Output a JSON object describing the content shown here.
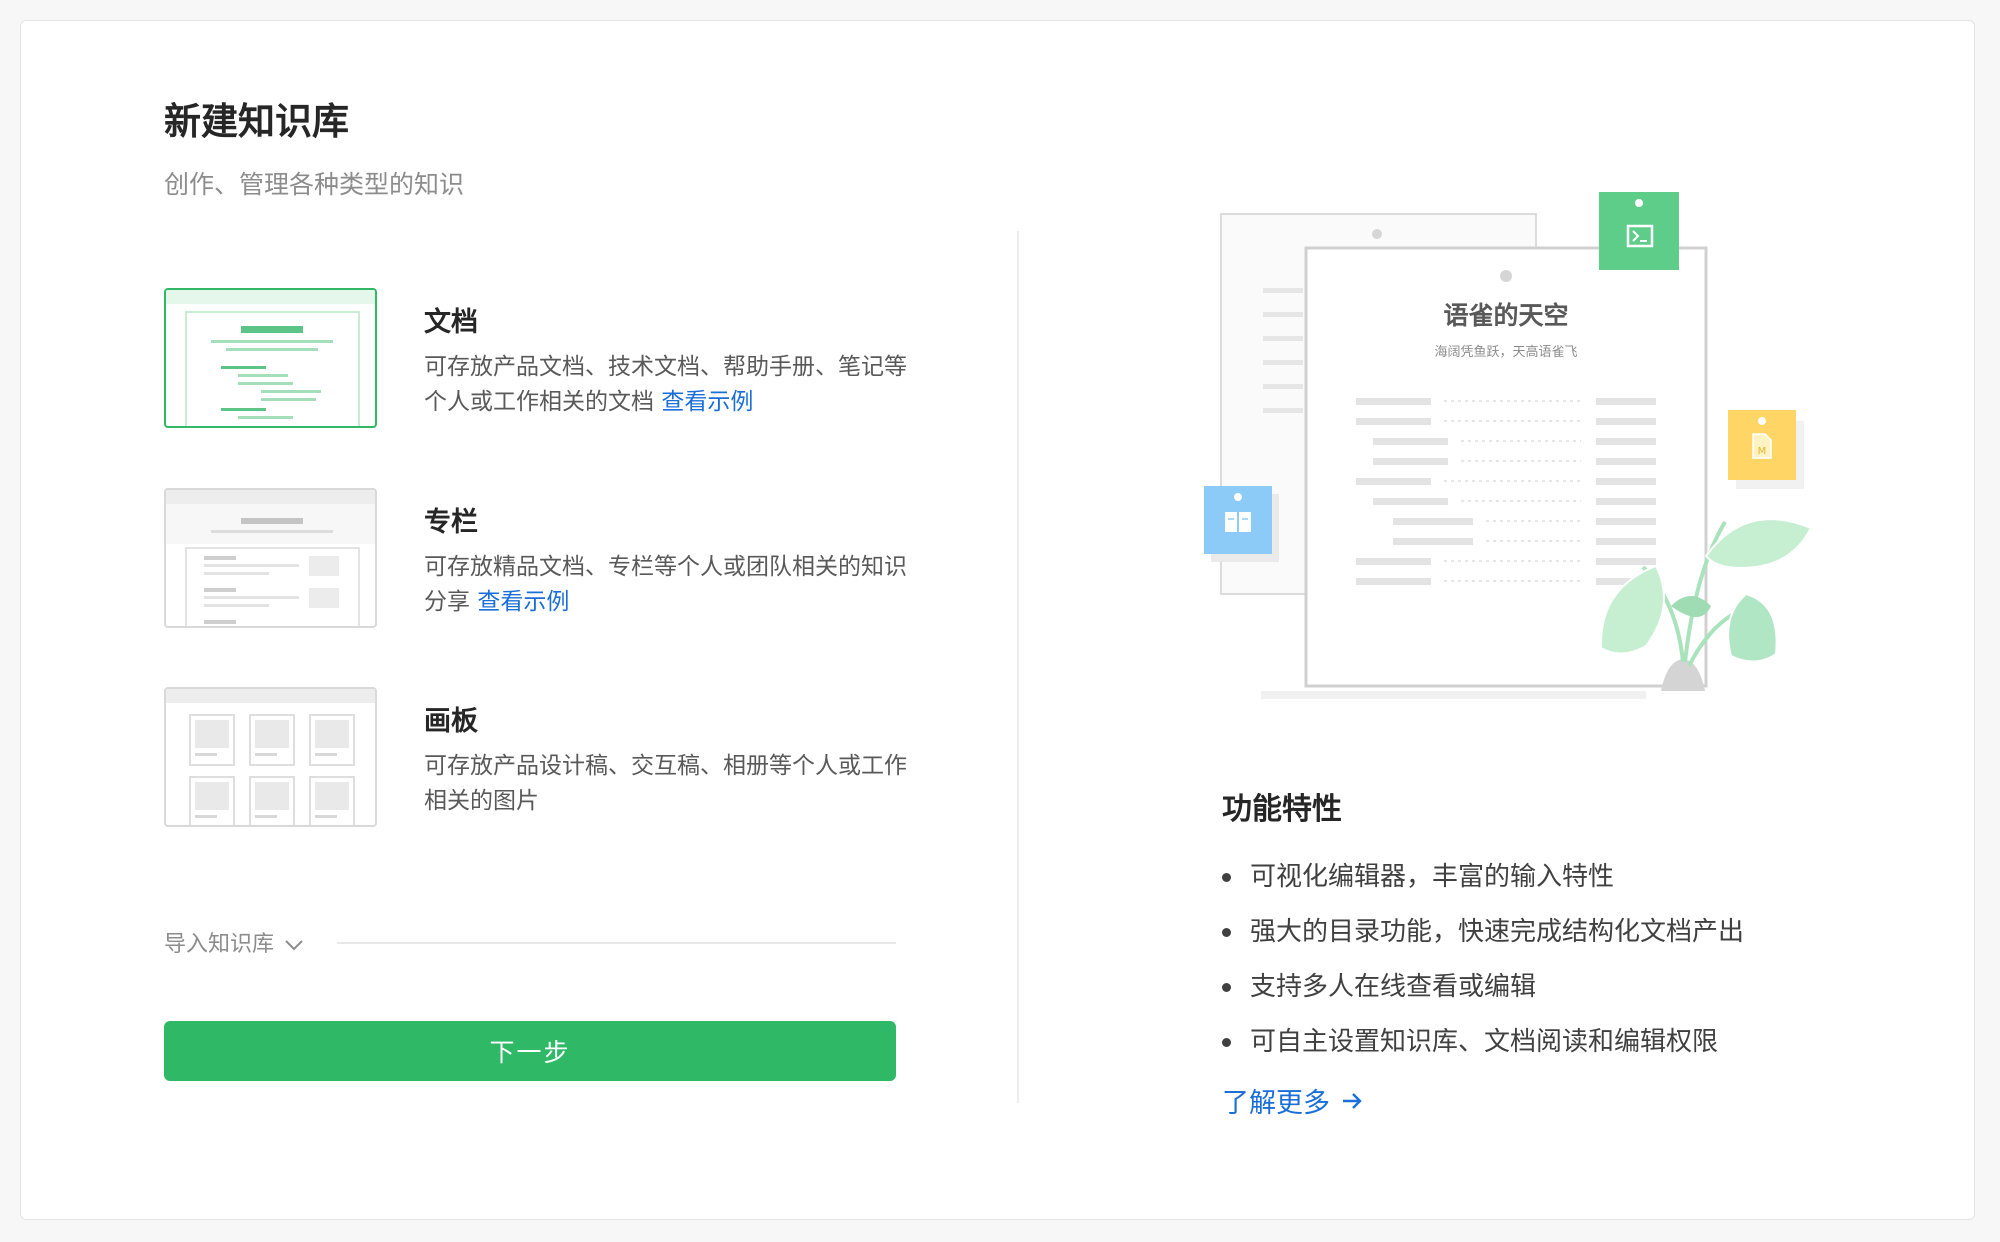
{
  "page": {
    "title": "新建知识库",
    "subtitle": "创作、管理各种类型的知识"
  },
  "options": [
    {
      "key": "doc",
      "title": "文档",
      "desc": "可存放产品文档、技术文档、帮助手册、笔记等个人或工作相关的文档 ",
      "link": "查看示例",
      "selected": true
    },
    {
      "key": "column",
      "title": "专栏",
      "desc": "可存放精品文档、专栏等个人或团队相关的知识分享 ",
      "link": "查看示例",
      "selected": false
    },
    {
      "key": "board",
      "title": "画板",
      "desc": "可存放产品设计稿、交互稿、相册等个人或工作相关的图片",
      "link": "",
      "selected": false
    }
  ],
  "import": {
    "label": "导入知识库"
  },
  "next_button": {
    "label": "下一步"
  },
  "illustration": {
    "doc_title": "语雀的天空",
    "doc_subtitle": "海阔凭鱼跃，天高语雀飞"
  },
  "features": {
    "title": "功能特性",
    "items": [
      "可视化编辑器，丰富的输入特性",
      "强大的目录功能，快速完成结构化文档产出",
      "支持多人在线查看或编辑",
      "可自主设置知识库、文档阅读和编辑权限"
    ],
    "learn_more": "了解更多"
  },
  "colors": {
    "accent_green": "#2fb865",
    "link_blue": "#1a6ed8",
    "tag_blue": "#8ccbf7",
    "tag_yellow": "#ffd666"
  }
}
